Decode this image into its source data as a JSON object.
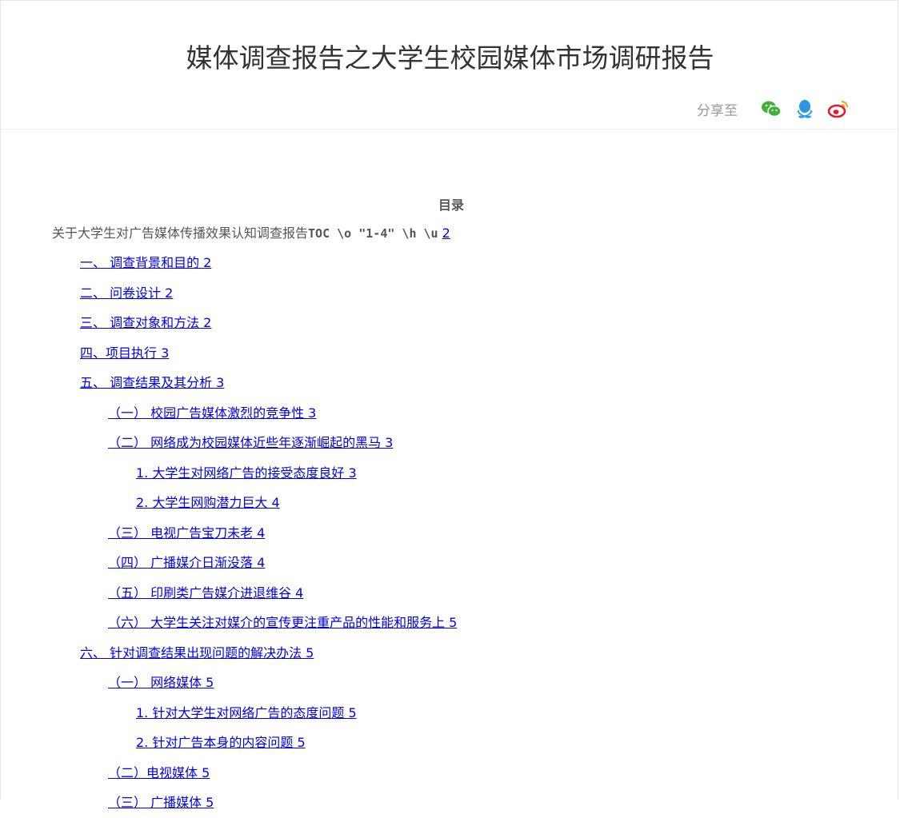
{
  "header": {
    "title": "媒体调查报告之大学生校园媒体市场调研报告",
    "share_label": "分享至",
    "share_icons": [
      "wechat-icon",
      "qq-icon",
      "weibo-icon"
    ]
  },
  "toc": {
    "heading": "目录",
    "intro_text": "关于大学生对广告媒体传播效果认知调查报告",
    "intro_code": "TOC \\o \"1-4\" \\h \\u",
    "intro_page": "2",
    "items": [
      {
        "text": "一、  调查背景和目的  2",
        "level": 1
      },
      {
        "text": "二、  问卷设计  2",
        "level": 1
      },
      {
        "text": "三、  调查对象和方法  2",
        "level": 1
      },
      {
        "text": "四、项目执行  3",
        "level": 1
      },
      {
        "text": "五、  调查结果及其分析  3",
        "level": 1
      },
      {
        "text": "（一）  校园广告媒体激烈的竞争性  3",
        "level": 2
      },
      {
        "text": "（二）  网络成为校园媒体近些年逐渐崛起的黑马  3",
        "level": 2
      },
      {
        "text": "1. 大学生对网络广告的接受态度良好  3",
        "level": 3
      },
      {
        "text": "2. 大学生网购潜力巨大  4",
        "level": 3
      },
      {
        "text": "（三）  电视广告宝刀未老  4",
        "level": 2
      },
      {
        "text": "（四）  广播媒介日渐没落  4",
        "level": 2
      },
      {
        "text": "（五）  印刷类广告媒介进退维谷  4",
        "level": 2
      },
      {
        "text": "（六）  大学生关注对媒介的宣传更注重产品的性能和服务上  5",
        "level": 2
      },
      {
        "text": "六、  针对调查结果出现问题的解决办法  5",
        "level": 1
      },
      {
        "text": "（一）  网络媒体  5",
        "level": 2
      },
      {
        "text": "1. 针对大学生对网络广告的态度问题  5",
        "level": 3
      },
      {
        "text": "2. 针对广告本身的内容问题  5",
        "level": 3
      },
      {
        "text": "（二）电视媒体  5",
        "level": 2
      },
      {
        "text": "（三）  广播媒体  5",
        "level": 2
      }
    ]
  },
  "colors": {
    "link": "#0000ee",
    "wechat": "#3fb137",
    "qq": "#2a96e8",
    "weibo": "#e6162d"
  }
}
